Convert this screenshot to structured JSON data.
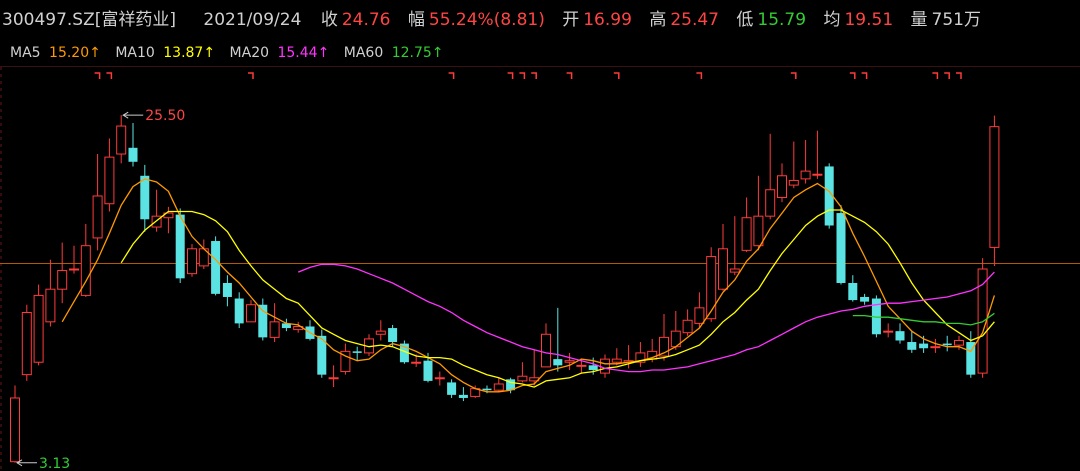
{
  "header": {
    "code": "300497.SZ",
    "name": "[富祥药业]",
    "date": "2021/09/24",
    "close_label": "收",
    "close": "24.76",
    "chg_label": "幅",
    "chg": "55.24%(8.81)",
    "open_label": "开",
    "open": "16.99",
    "high_label": "高",
    "high": "25.47",
    "low_label": "低",
    "low": "15.79",
    "avg_label": "均",
    "avg": "19.51",
    "vol_label": "量",
    "vol": "751万"
  },
  "ma": [
    {
      "label": "MA5",
      "value": "15.20",
      "arrow": "↑",
      "color": "#ff9900"
    },
    {
      "label": "MA10",
      "value": "13.87",
      "arrow": "↑",
      "color": "#ffff00"
    },
    {
      "label": "MA20",
      "value": "15.44",
      "arrow": "↑",
      "color": "#ff33ff"
    },
    {
      "label": "MA60",
      "value": "12.75",
      "arrow": "↑",
      "color": "#33cc33"
    }
  ],
  "colors": {
    "up": "#ff3b3b",
    "down": "#5be3e3",
    "text": "#d0d0d0",
    "red_text": "#ff4444",
    "green_text": "#33cc33",
    "ref_line": "#b35900",
    "grid": "#661a1a"
  },
  "chart_data": {
    "type": "candlestick",
    "annotations": [
      {
        "text": "25.50",
        "price": 25.5,
        "bar": 9
      },
      {
        "text": "3.13",
        "price": 3.13,
        "bar": 0
      }
    ],
    "reference_price": 15.95,
    "ylim": [
      2.6,
      28.6
    ],
    "candles": [
      [
        3.2,
        7.3,
        3.13,
        8.1
      ],
      [
        8.8,
        12.8,
        8.4,
        13.3
      ],
      [
        9.6,
        13.9,
        9.4,
        14.6
      ],
      [
        12.2,
        14.3,
        11.9,
        16.2
      ],
      [
        14.3,
        15.5,
        13.4,
        17.3
      ],
      [
        15.6,
        15.6,
        15.3,
        17.1
      ],
      [
        13.9,
        17.1,
        13.8,
        18.5
      ],
      [
        17.6,
        20.3,
        16.8,
        23.0
      ],
      [
        19.8,
        22.8,
        19.3,
        24.0
      ],
      [
        23.0,
        24.8,
        22.4,
        25.5
      ],
      [
        23.4,
        22.5,
        22.2,
        25.0
      ],
      [
        21.6,
        18.8,
        18.0,
        22.3
      ],
      [
        18.3,
        19.0,
        18.0,
        20.7
      ],
      [
        18.9,
        19.2,
        17.9,
        19.6
      ],
      [
        19.1,
        15.0,
        14.7,
        19.5
      ],
      [
        15.3,
        16.9,
        15.1,
        17.2
      ],
      [
        15.8,
        16.9,
        15.6,
        17.5
      ],
      [
        17.4,
        14.0,
        13.9,
        17.7
      ],
      [
        14.7,
        13.8,
        13.2,
        15.2
      ],
      [
        13.7,
        12.1,
        11.8,
        14.1
      ],
      [
        12.2,
        13.3,
        12.2,
        13.6
      ],
      [
        13.3,
        11.2,
        11.0,
        13.7
      ],
      [
        11.2,
        12.2,
        10.9,
        13.4
      ],
      [
        12.1,
        11.8,
        11.6,
        12.4
      ],
      [
        11.7,
        11.9,
        11.5,
        12.2
      ],
      [
        11.9,
        11.1,
        11.0,
        12.3
      ],
      [
        11.3,
        8.8,
        8.6,
        11.7
      ],
      [
        8.6,
        8.6,
        8.0,
        9.4
      ],
      [
        9.0,
        10.3,
        8.8,
        10.8
      ],
      [
        10.3,
        10.2,
        9.7,
        10.6
      ],
      [
        10.2,
        11.1,
        10.0,
        11.4
      ],
      [
        11.4,
        11.6,
        11.0,
        12.3
      ],
      [
        11.8,
        10.9,
        10.6,
        12.0
      ],
      [
        10.8,
        9.6,
        9.5,
        11.0
      ],
      [
        9.6,
        9.6,
        9.3,
        10.1
      ],
      [
        9.7,
        8.4,
        8.3,
        10.2
      ],
      [
        8.6,
        8.6,
        8.1,
        9.0
      ],
      [
        8.3,
        7.5,
        7.3,
        8.5
      ],
      [
        7.5,
        7.3,
        7.1,
        8.0
      ],
      [
        7.4,
        7.9,
        7.3,
        8.1
      ],
      [
        7.9,
        7.8,
        7.6,
        8.1
      ],
      [
        7.8,
        8.2,
        7.7,
        8.6
      ],
      [
        8.5,
        7.8,
        7.6,
        8.6
      ],
      [
        8.4,
        8.7,
        8.3,
        9.6
      ],
      [
        8.4,
        8.6,
        8.1,
        10.4
      ],
      [
        9.3,
        11.4,
        9.3,
        12.1
      ],
      [
        9.8,
        9.4,
        9.0,
        13.1
      ],
      [
        9.6,
        9.7,
        9.1,
        10.2
      ],
      [
        9.4,
        9.4,
        8.9,
        9.8
      ],
      [
        9.4,
        9.1,
        8.8,
        9.9
      ],
      [
        8.9,
        9.8,
        8.6,
        10.1
      ],
      [
        9.6,
        9.8,
        9.4,
        10.5
      ],
      [
        9.6,
        9.7,
        9.2,
        10.7
      ],
      [
        9.6,
        10.2,
        9.3,
        10.9
      ],
      [
        9.8,
        10.3,
        9.6,
        11.1
      ],
      [
        10.0,
        11.2,
        9.7,
        12.7
      ],
      [
        10.6,
        11.6,
        10.4,
        12.9
      ],
      [
        11.5,
        12.3,
        11.3,
        13.0
      ],
      [
        12.1,
        13.1,
        11.8,
        14.1
      ],
      [
        12.4,
        16.4,
        12.2,
        17.0
      ],
      [
        14.3,
        16.9,
        14.2,
        18.5
      ],
      [
        15.4,
        15.6,
        15.2,
        19.0
      ],
      [
        16.8,
        18.9,
        16.7,
        20.2
      ],
      [
        17.1,
        19.0,
        16.8,
        21.6
      ],
      [
        19.0,
        20.7,
        18.8,
        24.3
      ],
      [
        20.2,
        21.6,
        19.9,
        22.4
      ],
      [
        21.0,
        21.3,
        20.8,
        23.8
      ],
      [
        21.4,
        21.9,
        21.1,
        23.9
      ],
      [
        21.7,
        21.7,
        21.4,
        24.5
      ],
      [
        22.2,
        18.4,
        18.2,
        22.4
      ],
      [
        19.2,
        14.7,
        14.6,
        19.7
      ],
      [
        14.7,
        13.6,
        13.5,
        15.2
      ],
      [
        13.8,
        13.5,
        13.3,
        14.0
      ],
      [
        13.7,
        11.4,
        11.2,
        13.9
      ],
      [
        11.6,
        11.6,
        11.2,
        12.1
      ],
      [
        11.6,
        11.0,
        10.8,
        12.1
      ],
      [
        10.9,
        10.4,
        10.2,
        11.6
      ],
      [
        10.8,
        10.5,
        10.2,
        11.3
      ],
      [
        10.6,
        10.6,
        10.2,
        11.1
      ],
      [
        10.8,
        10.7,
        10.3,
        11.3
      ],
      [
        10.7,
        11.0,
        10.4,
        11.3
      ],
      [
        10.9,
        8.8,
        8.6,
        11.6
      ],
      [
        8.9,
        15.6,
        8.6,
        16.3
      ],
      [
        16.99,
        24.76,
        15.79,
        25.47
      ]
    ],
    "series": [
      {
        "name": "MA5",
        "color": "#ff9900",
        "values": [
          null,
          null,
          null,
          null,
          12.2,
          13.5,
          14.8,
          16.2,
          17.9,
          19.7,
          20.9,
          21.4,
          21.2,
          20.6,
          19.0,
          17.7,
          16.9,
          16.2,
          15.4,
          14.7,
          13.8,
          12.9,
          12.5,
          12.1,
          12.0,
          11.5,
          11.1,
          10.4,
          10.0,
          9.7,
          9.8,
          10.4,
          10.8,
          10.6,
          10.3,
          9.9,
          9.5,
          8.8,
          8.3,
          7.9,
          7.7,
          7.7,
          7.8,
          8.1,
          8.2,
          9.0,
          9.2,
          9.4,
          9.8,
          9.7,
          9.5,
          9.5,
          9.6,
          9.7,
          9.9,
          10.2,
          10.6,
          11.2,
          11.8,
          12.9,
          14.1,
          14.9,
          16.1,
          16.9,
          18.2,
          19.2,
          20.2,
          20.7,
          21.1,
          20.6,
          19.6,
          17.9,
          16.4,
          14.8,
          13.2,
          12.4,
          11.6,
          11.1,
          10.8,
          10.6,
          10.6,
          10.3,
          11.5,
          13.9
        ]
      },
      {
        "name": "MA10",
        "color": "#ffff00",
        "values": [
          null,
          null,
          null,
          null,
          null,
          null,
          null,
          null,
          null,
          16.0,
          17.2,
          18.1,
          18.7,
          19.3,
          19.3,
          19.3,
          19.1,
          18.7,
          18.0,
          16.8,
          15.8,
          14.9,
          14.3,
          13.7,
          13.4,
          12.6,
          11.8,
          11.4,
          11.0,
          10.8,
          10.6,
          10.7,
          10.6,
          10.3,
          10.0,
          9.9,
          9.9,
          9.8,
          9.4,
          9.1,
          8.8,
          8.6,
          8.3,
          8.2,
          8.0,
          8.4,
          8.5,
          8.6,
          8.9,
          9.0,
          9.2,
          9.3,
          9.5,
          9.7,
          9.8,
          9.9,
          10.1,
          10.4,
          10.7,
          11.4,
          12.2,
          12.8,
          13.6,
          14.3,
          15.5,
          16.6,
          17.5,
          18.4,
          19.0,
          19.4,
          19.4,
          19.0,
          18.6,
          18.0,
          17.2,
          16.0,
          14.7,
          13.6,
          12.8,
          12.0,
          11.5,
          11.0,
          11.3,
          12.2
        ]
      },
      {
        "name": "MA20",
        "color": "#ff33ff",
        "values": [
          null,
          null,
          null,
          null,
          null,
          null,
          null,
          null,
          null,
          null,
          null,
          null,
          null,
          null,
          null,
          null,
          null,
          null,
          null,
          null,
          null,
          null,
          null,
          null,
          15.4,
          15.7,
          15.9,
          15.9,
          15.8,
          15.6,
          15.3,
          15.0,
          14.7,
          14.3,
          13.9,
          13.5,
          13.2,
          12.8,
          12.3,
          11.9,
          11.5,
          11.2,
          10.9,
          10.6,
          10.4,
          10.2,
          10.1,
          9.9,
          9.7,
          9.5,
          9.2,
          9.1,
          9.0,
          9.0,
          9.1,
          9.1,
          9.2,
          9.3,
          9.5,
          9.7,
          9.9,
          10.1,
          10.4,
          10.6,
          11.0,
          11.4,
          11.8,
          12.2,
          12.5,
          12.7,
          12.9,
          13.0,
          13.2,
          13.3,
          13.4,
          13.4,
          13.5,
          13.6,
          13.7,
          13.8,
          14.0,
          14.2,
          14.6,
          15.4
        ]
      },
      {
        "name": "MA60",
        "color": "#33cc33",
        "values": [
          null,
          null,
          null,
          null,
          null,
          null,
          null,
          null,
          null,
          null,
          null,
          null,
          null,
          null,
          null,
          null,
          null,
          null,
          null,
          null,
          null,
          null,
          null,
          null,
          null,
          null,
          null,
          null,
          null,
          null,
          null,
          null,
          null,
          null,
          null,
          null,
          null,
          null,
          null,
          null,
          null,
          null,
          null,
          null,
          null,
          null,
          null,
          null,
          null,
          null,
          null,
          null,
          null,
          null,
          null,
          null,
          null,
          null,
          null,
          null,
          null,
          null,
          null,
          null,
          null,
          null,
          null,
          null,
          null,
          null,
          null,
          12.6,
          12.6,
          12.5,
          12.5,
          12.4,
          12.3,
          12.2,
          12.2,
          12.1,
          12.1,
          12.0,
          12.2,
          12.75
        ]
      }
    ]
  }
}
